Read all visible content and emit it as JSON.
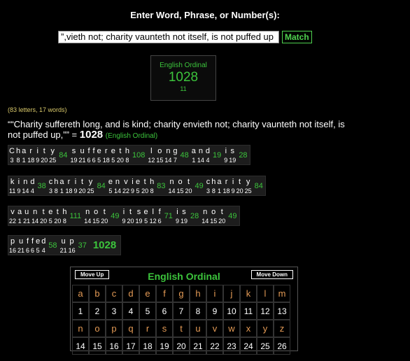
{
  "header": {
    "title": "Enter Word, Phrase, or Number(s):",
    "input_value": "vieth not; charity vaunteth not itself, is not puffed up,”",
    "match_label": "Match"
  },
  "cipher_box": {
    "name": "English Ordinal",
    "value": "1028",
    "reduced": "11"
  },
  "counts": "(83 letters, 17 words)",
  "phrase": {
    "text": "““Charity suffereth long, and is kind; charity envieth not; charity vaunteth not itself, is not puffed up,”” =",
    "total": "1028",
    "cipher": "(English Ordinal)"
  },
  "word_rows": [
    [
      {
        "word": "Charity",
        "value": "84",
        "letters": [
          "C",
          "h",
          "a",
          "r",
          "i",
          "t",
          "y"
        ],
        "nums": [
          "3",
          "8",
          "1",
          "18",
          "9",
          "20",
          "25"
        ]
      },
      {
        "word": "suffereth",
        "value": "108",
        "letters": [
          "s",
          "u",
          "f",
          "f",
          "e",
          "r",
          "e",
          "t",
          "h"
        ],
        "nums": [
          "19",
          "21",
          "6",
          "6",
          "5",
          "18",
          "5",
          "20",
          "8"
        ]
      },
      {
        "word": "long",
        "value": "48",
        "letters": [
          "l",
          "o",
          "n",
          "g"
        ],
        "nums": [
          "12",
          "15",
          "14",
          "7"
        ]
      },
      {
        "word": "and",
        "value": "19",
        "letters": [
          "a",
          "n",
          "d"
        ],
        "nums": [
          "1",
          "14",
          "4"
        ]
      },
      {
        "word": "is",
        "value": "28",
        "letters": [
          "i",
          "s"
        ],
        "nums": [
          "9",
          "19"
        ]
      }
    ],
    [
      {
        "word": "kind",
        "value": "38",
        "letters": [
          "k",
          "i",
          "n",
          "d"
        ],
        "nums": [
          "11",
          "9",
          "14",
          "4"
        ]
      },
      {
        "word": "charity",
        "value": "84",
        "letters": [
          "c",
          "h",
          "a",
          "r",
          "i",
          "t",
          "y"
        ],
        "nums": [
          "3",
          "8",
          "1",
          "18",
          "9",
          "20",
          "25"
        ]
      },
      {
        "word": "envieth",
        "value": "83",
        "letters": [
          "e",
          "n",
          "v",
          "i",
          "e",
          "t",
          "h"
        ],
        "nums": [
          "5",
          "14",
          "22",
          "9",
          "5",
          "20",
          "8"
        ]
      },
      {
        "word": "not",
        "value": "49",
        "letters": [
          "n",
          "o",
          "t"
        ],
        "nums": [
          "14",
          "15",
          "20"
        ]
      },
      {
        "word": "charity",
        "value": "84",
        "letters": [
          "c",
          "h",
          "a",
          "r",
          "i",
          "t",
          "y"
        ],
        "nums": [
          "3",
          "8",
          "1",
          "18",
          "9",
          "20",
          "25"
        ]
      }
    ],
    [
      {
        "word": "vaunteth",
        "value": "111",
        "letters": [
          "v",
          "a",
          "u",
          "n",
          "t",
          "e",
          "t",
          "h"
        ],
        "nums": [
          "22",
          "1",
          "21",
          "14",
          "20",
          "5",
          "20",
          "8"
        ]
      },
      {
        "word": "not",
        "value": "49",
        "letters": [
          "n",
          "o",
          "t"
        ],
        "nums": [
          "14",
          "15",
          "20"
        ]
      },
      {
        "word": "itself",
        "value": "71",
        "letters": [
          "i",
          "t",
          "s",
          "e",
          "l",
          "f"
        ],
        "nums": [
          "9",
          "20",
          "19",
          "5",
          "12",
          "6"
        ]
      },
      {
        "word": "is",
        "value": "28",
        "letters": [
          "i",
          "s"
        ],
        "nums": [
          "9",
          "19"
        ]
      },
      {
        "word": "not",
        "value": "49",
        "letters": [
          "n",
          "o",
          "t"
        ],
        "nums": [
          "14",
          "15",
          "20"
        ]
      }
    ],
    [
      {
        "word": "puffed",
        "value": "58",
        "letters": [
          "p",
          "u",
          "f",
          "f",
          "e",
          "d"
        ],
        "nums": [
          "16",
          "21",
          "6",
          "6",
          "5",
          "4"
        ]
      },
      {
        "word": "up",
        "value": "37",
        "letters": [
          "u",
          "p"
        ],
        "nums": [
          "21",
          "16"
        ]
      }
    ]
  ],
  "grand_total": "1028",
  "table": {
    "title": "English Ordinal",
    "move_up": "Move Up",
    "move_down": "Move Down",
    "row1_letters": [
      "a",
      "b",
      "c",
      "d",
      "e",
      "f",
      "g",
      "h",
      "i",
      "j",
      "k",
      "l",
      "m"
    ],
    "row1_nums": [
      "1",
      "2",
      "3",
      "4",
      "5",
      "6",
      "7",
      "8",
      "9",
      "10",
      "11",
      "12",
      "13"
    ],
    "row2_letters": [
      "n",
      "o",
      "p",
      "q",
      "r",
      "s",
      "t",
      "u",
      "v",
      "w",
      "x",
      "y",
      "z"
    ],
    "row2_nums": [
      "14",
      "15",
      "16",
      "17",
      "18",
      "19",
      "20",
      "21",
      "22",
      "23",
      "24",
      "25",
      "26"
    ]
  }
}
